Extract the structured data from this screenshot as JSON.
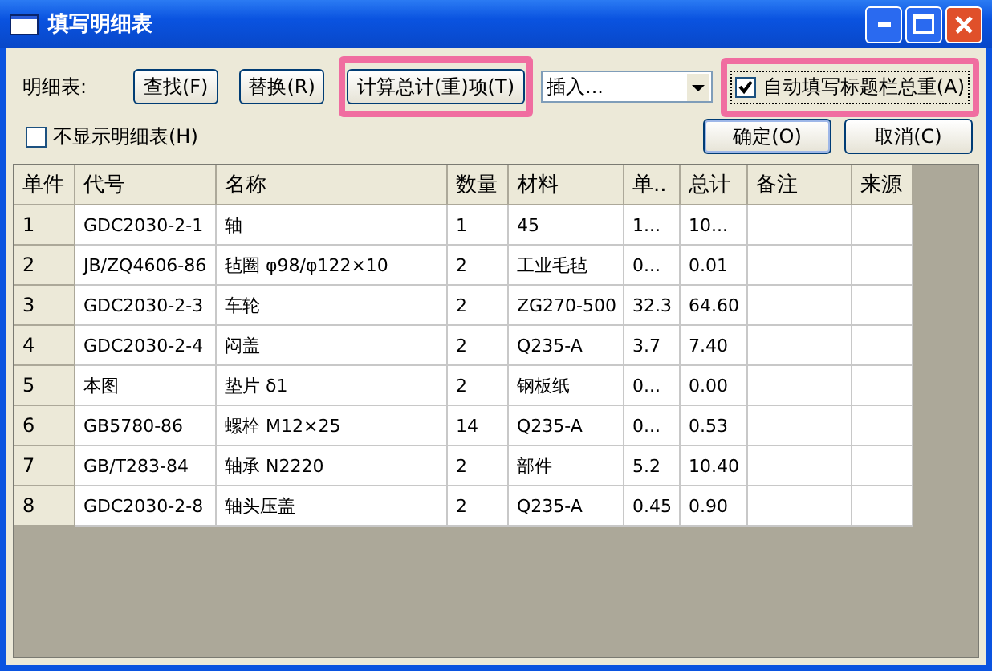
{
  "window": {
    "title": "填写明细表"
  },
  "toolbar": {
    "label": "明细表:",
    "buttons": [
      {
        "label": "查找(F)",
        "highlighted": false
      },
      {
        "label": "替换(R)",
        "highlighted": false
      },
      {
        "label": "计算总计(重)项(T)",
        "highlighted": true
      }
    ],
    "insert_combo": {
      "value": "插入..."
    },
    "auto_fill": {
      "label": "自动填写标题栏总重(A)",
      "checked": true,
      "highlighted": true
    }
  },
  "hide_table": {
    "label": "不显示明细表(H)",
    "checked": false
  },
  "dialog_buttons": [
    "确定(O)",
    "取消(C)"
  ],
  "table": {
    "columns": [
      "单件",
      "代号",
      "名称",
      "数量",
      "材料",
      "单..",
      "总计",
      "备注",
      "来源"
    ],
    "rows": [
      [
        "1",
        "GDC2030-2-1",
        "轴",
        "1",
        "45",
        "1...",
        "10..."
      ],
      [
        "2",
        "JB/ZQ4606-86",
        "毡圈 φ98/φ122×10",
        "2",
        "工业毛毡",
        "0...",
        "0.01"
      ],
      [
        "3",
        "GDC2030-2-3",
        "车轮",
        "2",
        "ZG270-500",
        "32.3",
        "64.60"
      ],
      [
        "4",
        "GDC2030-2-4",
        "闷盖",
        "2",
        "Q235-A",
        "3.7",
        "7.40"
      ],
      [
        "5",
        "本图",
        "垫片 δ1",
        "2",
        "钢板纸",
        "0...",
        "0.00"
      ],
      [
        "6",
        "GB5780-86",
        "螺栓 M12×25",
        "14",
        "Q235-A",
        "0...",
        "0.53"
      ],
      [
        "7",
        "GB/T283-84",
        "轴承 N2220",
        "2",
        "部件",
        "5.2",
        "10.40"
      ],
      [
        "8",
        "GDC2030-2-8",
        "轴头压盖",
        "2",
        "Q235-A",
        "0.45",
        "0.90"
      ]
    ]
  }
}
